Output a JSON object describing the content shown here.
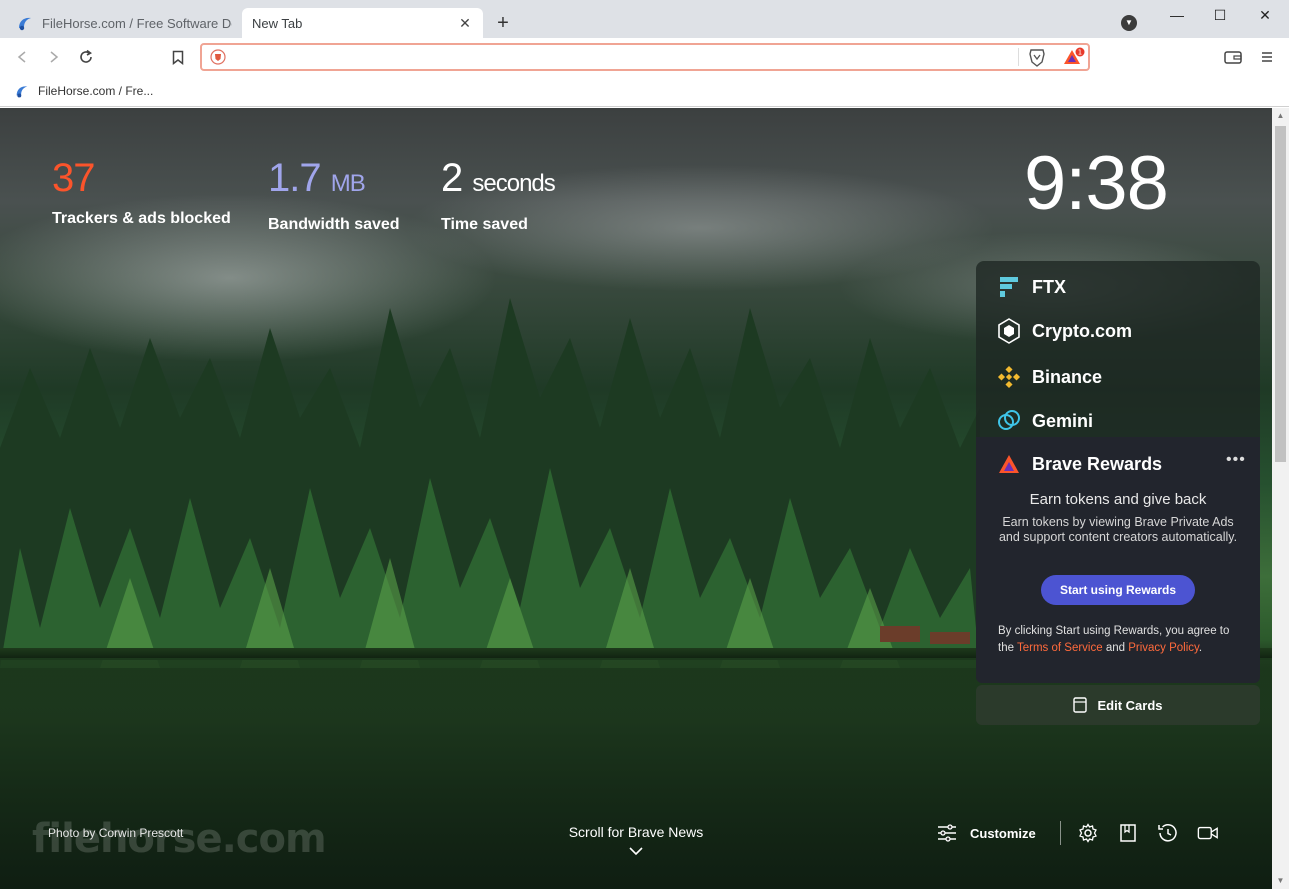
{
  "tabs": [
    {
      "title": "FileHorse.com / Free Software Download",
      "active": false
    },
    {
      "title": "New Tab",
      "active": true
    }
  ],
  "window_controls": {
    "minimize": "—",
    "maximize": "☐",
    "close": "✕"
  },
  "address_bar": {
    "value": "",
    "placeholder": ""
  },
  "bookmarks": [
    {
      "label": "FileHorse.com / Fre..."
    }
  ],
  "stats": {
    "trackers": {
      "value": "37",
      "label": "Trackers & ads blocked",
      "color": "#fb542b"
    },
    "bandwidth": {
      "value": "1.7",
      "unit": "MB",
      "label": "Bandwidth saved",
      "color": "#a0a5eb"
    },
    "time": {
      "value": "2",
      "unit": "seconds",
      "label": "Time saved",
      "color": "#ffffff"
    }
  },
  "clock": "9:38",
  "cards": [
    {
      "name": "FTX",
      "icon": "ftx-icon"
    },
    {
      "name": "Crypto.com",
      "icon": "crypto-com-icon"
    },
    {
      "name": "Binance",
      "icon": "binance-icon"
    },
    {
      "name": "Gemini",
      "icon": "gemini-icon"
    }
  ],
  "rewards": {
    "title": "Brave Rewards",
    "more": "•••",
    "subtitle": "Earn tokens and give back",
    "description": "Earn tokens by viewing Brave Private Ads and support content creators automatically.",
    "button": "Start using Rewards",
    "legal_prefix": "By clicking Start using Rewards, you agree to the ",
    "terms": "Terms of Service",
    "and": " and ",
    "privacy": "Privacy Policy",
    "legal_suffix": ".",
    "button_color": "#4c54d2",
    "link_color": "#ff6a3c"
  },
  "edit_cards": "Edit Cards",
  "photo_credit": "Photo by Corwin Prescott",
  "watermark": "filehorse.com",
  "news": "Scroll for Brave News",
  "customize": "Customize",
  "colors": {
    "brave_orange": "#fb542b",
    "rewards_purple": "#4c54d2"
  }
}
